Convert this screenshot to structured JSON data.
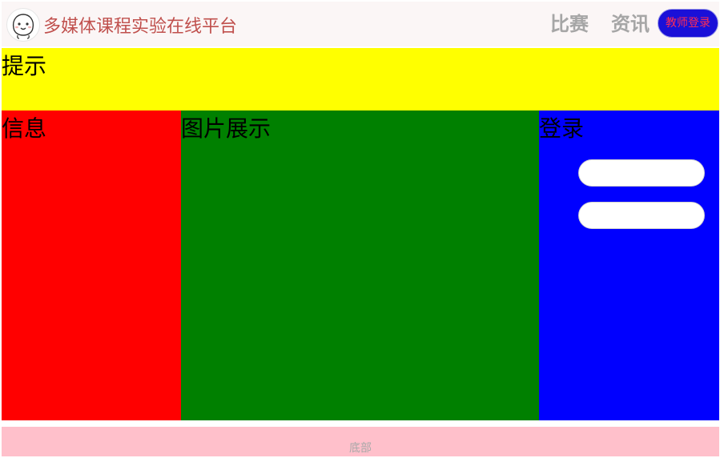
{
  "header": {
    "site_title": "多媒体课程实验在线平台",
    "logo_icon": "smiley-face-icon",
    "nav": {
      "compete_label": "比赛",
      "news_label": "资讯"
    },
    "teacher_login_label": "教师登录"
  },
  "notice": {
    "label": "提示"
  },
  "info": {
    "label": "信息"
  },
  "gallery": {
    "label": "图片展示"
  },
  "login": {
    "label": "登录",
    "username": {
      "value": "",
      "placeholder": ""
    },
    "password": {
      "value": "",
      "placeholder": ""
    }
  },
  "footer": {
    "text": "底部"
  },
  "colors": {
    "header_bg": "#fbf6f6",
    "site_title": "#c0504d",
    "nav_link": "#a6a6a6",
    "teacher_login_bg": "#1a10d8",
    "teacher_login_text": "#ff2d55",
    "notice_bg": "#ffff00",
    "info_bg": "#ff0000",
    "gallery_bg": "#008000",
    "login_bg": "#0000ff",
    "footer_bg": "#ffc0cb",
    "footer_text": "#a9a9a9"
  }
}
